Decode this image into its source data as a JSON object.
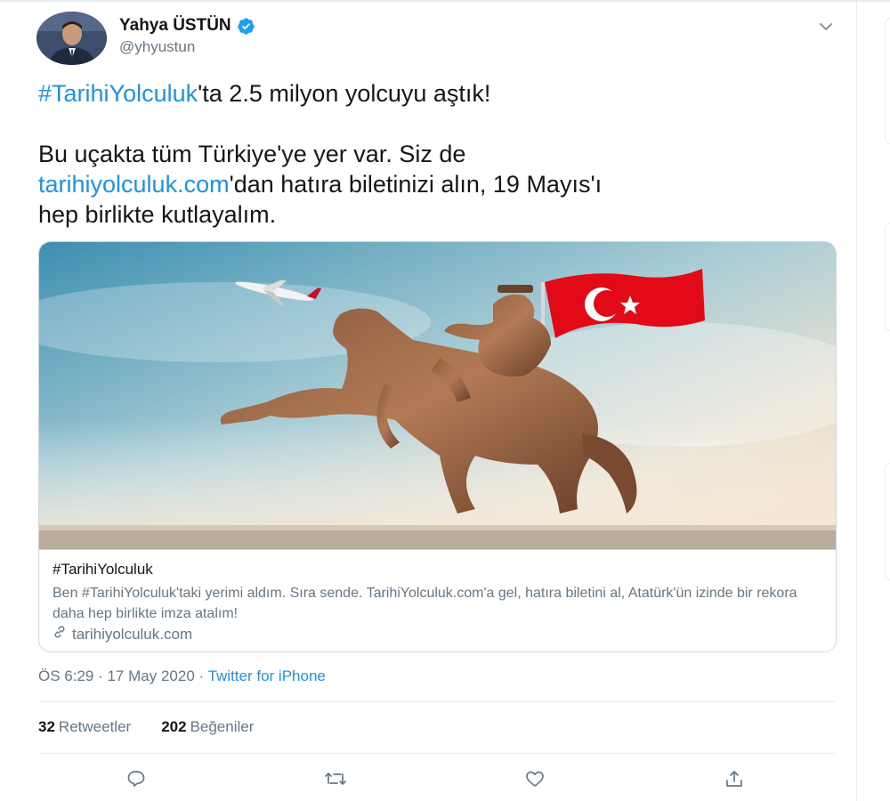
{
  "author": {
    "name": "Yahya ÜSTÜN",
    "handle": "@yhyustun",
    "verified": true,
    "icons": {
      "verified": "verified-badge-icon",
      "more": "chevron-down-icon"
    }
  },
  "tweet": {
    "line1_hashtag": "#TarihiYolculuk",
    "line1_rest": "'ta 2.5 milyon yolcuyu aştık!",
    "line2_start": "Bu uçakta tüm Türkiye'ye yer var. Siz de",
    "line3_link": "tarihiyolculuk.com",
    "line3_rest": "'dan hatıra biletinizi alın, 19 Mayıs'ı",
    "line4": "hep birlikte kutlayalım."
  },
  "card": {
    "title": "#TarihiYolculuk",
    "description": "Ben #TarihiYolculuk'taki yerimi aldım. Sıra sende. TarihiYolculuk.com'a gel, hatıra biletini al, Atatürk'ün izinde bir rekora daha hep birlikte imza atalım!",
    "domain": "tarihiyolculuk.com",
    "link_icon": "link-icon"
  },
  "meta": {
    "time": "ÖS 6:29 · 17 May 2020 · ",
    "source": "Twitter for iPhone"
  },
  "stats": {
    "retweets_count": "32",
    "retweets_label": "Retweetler",
    "likes_count": "202",
    "likes_label": "Beğeniler"
  },
  "actions": [
    "reply-icon",
    "retweet-icon",
    "like-icon",
    "share-icon"
  ],
  "colors": {
    "accent": "#1b95e0",
    "secondary_text": "#657786",
    "border": "#e6ecf0",
    "flag_red": "#e30a17"
  }
}
